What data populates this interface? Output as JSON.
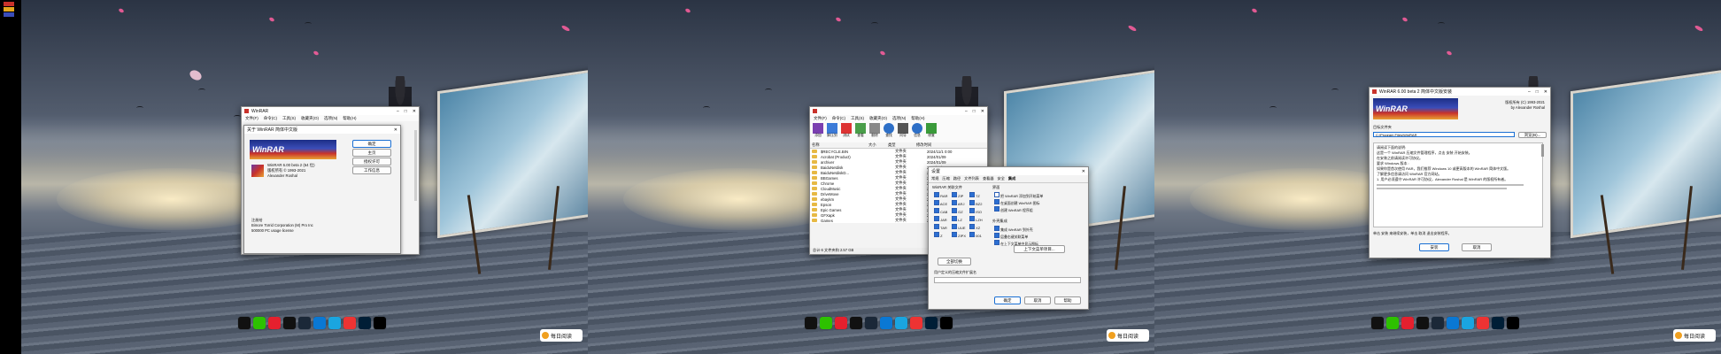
{
  "panels": [
    {
      "dialog": {
        "window_title": "WinRAR",
        "menu": [
          "文件(F)",
          "命令(C)",
          "工具(S)",
          "收藏夹(O)",
          "选项(N)",
          "帮助(H)"
        ],
        "about_title": "关于 WinRAR 简体中文版",
        "logo_text": "WinRAR",
        "version_text": "WinRAR 6.00 beta 2 (64 位)",
        "copyright_text": "版权所有 © 1993-2021",
        "author_text": "Alexander Roshal",
        "buttons": [
          "确定",
          "主页",
          "授权许可",
          "工作信息"
        ],
        "license_label": "注册给",
        "license_value": "Bimore Torrid Corporation (M) Pro Inc",
        "license_type": "500000 PC usage license"
      }
    },
    {
      "file_window": {
        "toolbar": [
          "添加",
          "解压到",
          "测试",
          "查看",
          "删除",
          "查找",
          "向导",
          "信息",
          "修复"
        ],
        "columns": [
          "名称",
          "大小",
          "类型",
          "修改时间"
        ],
        "rows": [
          {
            "name": "$RECYCLE.BIN",
            "type": "文件夹",
            "date": "2024/11/1 0:00"
          },
          {
            "name": "Acrobat (Product)",
            "type": "文件夹",
            "date": "2024/01/09"
          },
          {
            "name": "archiver",
            "type": "文件夹",
            "date": "2024/01/09"
          },
          {
            "name": "BaiduNetdisk",
            "type": "文件夹",
            "date": "2024/01/09"
          },
          {
            "name": "BaiduNetdiskD...",
            "type": "文件夹",
            "date": "2024/01/09"
          },
          {
            "name": "BBGames",
            "type": "文件夹",
            "date": "2024/01/09"
          },
          {
            "name": "Chrome",
            "type": "文件夹",
            "date": "2024/01/09"
          },
          {
            "name": "CloudMusic",
            "type": "文件夹",
            "date": "2024/01/09"
          },
          {
            "name": "DriveMove",
            "type": "文件夹",
            "date": "2024/01/09"
          },
          {
            "name": "ebaykm",
            "type": "文件夹",
            "date": "2024/01/09"
          },
          {
            "name": "Epson",
            "type": "文件夹",
            "date": "2024/01/09"
          },
          {
            "name": "Epic Games",
            "type": "文件夹",
            "date": "2024/01/09"
          },
          {
            "name": "GFXapk",
            "type": "文件夹",
            "date": "2024/01/09"
          },
          {
            "name": "Games",
            "type": "文件夹",
            "date": "2024/01/09"
          }
        ],
        "status": "总计 6 文件夹和 2.57 GB"
      },
      "settings": {
        "title": "设置",
        "tabs": [
          "常规",
          "压缩",
          "路径",
          "文件列表",
          "查看器",
          "安全",
          "集成"
        ],
        "assoc_label": "WinRAR 关联文件",
        "assoc_items": [
          "RAR",
          "ZIP",
          "7Z",
          "ACE",
          "ARJ",
          "BZ2",
          "CAB",
          "GZ",
          "ISO",
          "JAR",
          "LZ",
          "LZH",
          "TAR",
          "UUE",
          "XZ",
          "Z",
          "ZIPX",
          "001"
        ],
        "interface_label": "界面",
        "interface_options": [
          "把 WinRAR 添加到开始菜单",
          "在桌面创建 WinRAR 图标",
          "创建 WinRAR 程序组"
        ],
        "shell_label": "外壳集成",
        "shell_options": [
          "集成 WinRAR 到外壳",
          "层叠右键关联菜单",
          "在上下文菜单中显示图标"
        ],
        "context_button": "上下文菜单项目...",
        "toggle_all": "全部切换",
        "exclude_label": "用户定义的压缩文件扩展名",
        "ok": "确定",
        "cancel": "取消",
        "help": "帮助"
      }
    },
    {
      "installer": {
        "title": "WinRAR 6.00 beta 2 简体中文版安装",
        "copyright": "版权所有 (C) 1993-2021",
        "author": "by Alexander Roshal",
        "dest_label": "目标文件夹",
        "dest_value": "C:\\Program Files\\WinRAR",
        "browse": "浏览(B)...",
        "info_title": "请阅读下面的说明:",
        "info_lines": [
          "这是一个 WinRAR 压缩文件管理程序，点击 安装 开始安装。",
          "在安装之前请阅读许可协议。",
          "要求 Windows 版本 :",
          "如果你是首次使用 RAR，我们推荐 Windows 10 或更高版本的 WinRAR 简体中文版。",
          "了解更多信息请访问 WinRAR 官方网站。",
          "1. 用户必须遵守 WinRAR 许可协议，Alexander Roshal 是 WinRAR 的版权所有者。"
        ],
        "footer_note": "单击 安装 来继续安装，单击 取消 退出安装程序。",
        "install": "安装",
        "cancel": "取消"
      }
    }
  ],
  "taskbar_icons": [
    "qq-icon",
    "wechat-icon",
    "netease-music-icon",
    "tiktok-icon",
    "steam-icon",
    "windows-icon",
    "edge-icon",
    "wps-icon",
    "photoshop-icon",
    "capcut-icon"
  ],
  "news_button": "每日阅读",
  "colors": {
    "accent": "#1a6fd3",
    "winrar_blue": "#1d2f86",
    "winrar_red": "#c8322b",
    "petal": "#ff5fa0"
  }
}
